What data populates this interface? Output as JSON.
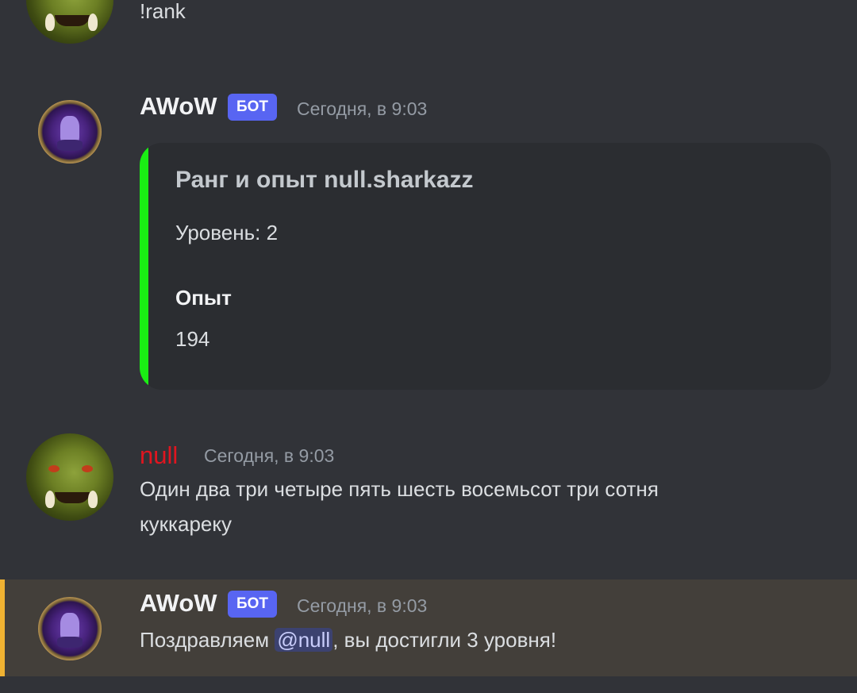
{
  "messages": [
    {
      "author": "",
      "text": "!rank"
    },
    {
      "author": "AWoW",
      "badge": "БОТ",
      "timestamp": "Сегодня, в 9:03",
      "embed": {
        "color": "#1aee14",
        "title": "Ранг и опыт null.sharkazz",
        "description": "Уровень: 2",
        "field_name": "Опыт",
        "field_value": "194"
      }
    },
    {
      "author": "null",
      "author_color": "#e0151f",
      "timestamp": "Сегодня, в 9:03",
      "text_line1": "Один два три четыре пять шесть восемьсот три сотня",
      "text_line2": "куккареку"
    },
    {
      "author": "AWoW",
      "badge": "БОТ",
      "timestamp": "Сегодня, в 9:03",
      "text_before": "Поздравляем ",
      "mention": "@null",
      "text_after": ", вы достигли 3 уровня!",
      "highlighted": true
    }
  ],
  "icons": {
    "user_avatar": "orc-avatar-icon",
    "bot_avatar": "bot-avatar-icon"
  },
  "colors": {
    "background": "#313338",
    "embed_background": "#2b2d31",
    "bot_badge": "#5865f2",
    "mention_highlight_row": "#433f3a",
    "mention_highlight_edge": "#f0b232"
  }
}
